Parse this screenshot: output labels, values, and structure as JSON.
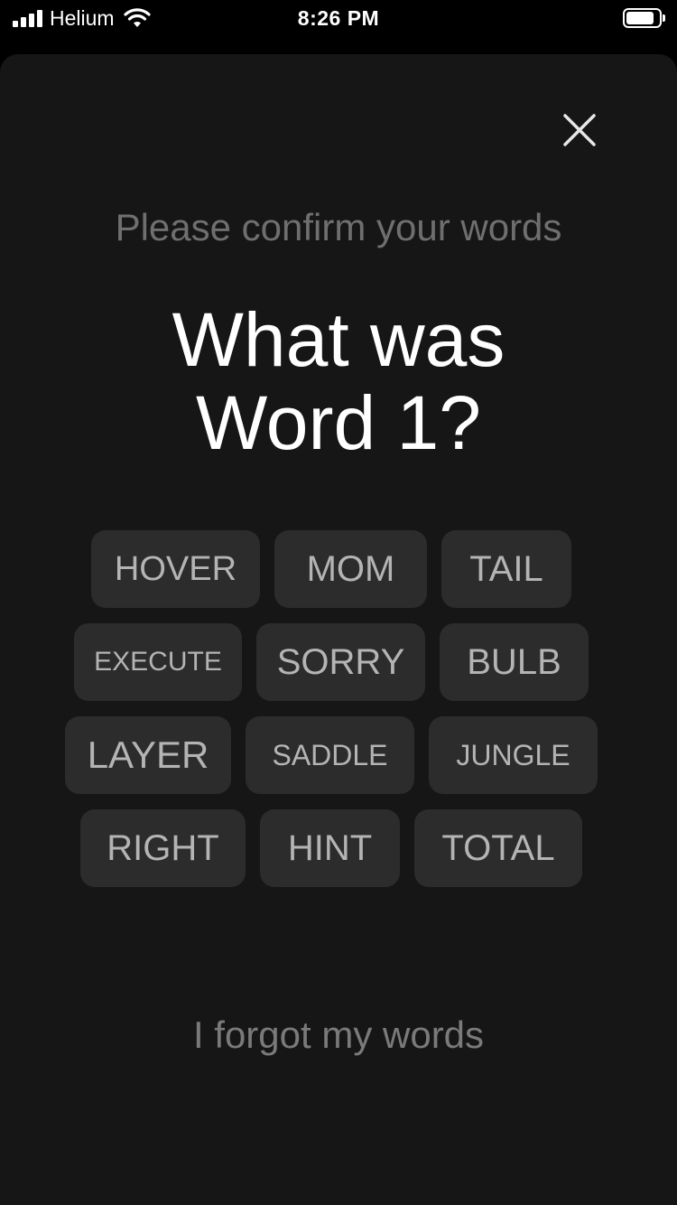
{
  "status_bar": {
    "carrier": "Helium",
    "time": "8:26 PM"
  },
  "confirm_words": {
    "subtitle": "Please confirm your words",
    "question_line1": "What was",
    "question_line2": "Word 1?",
    "chips": [
      [
        "HOVER",
        "MOM",
        "TAIL"
      ],
      [
        "EXECUTE",
        "SORRY",
        "BULB"
      ],
      [
        "LAYER",
        "SADDLE",
        "JUNGLE"
      ],
      [
        "RIGHT",
        "HINT",
        "TOTAL"
      ]
    ],
    "forgot_label": "I forgot my words"
  },
  "icons": {
    "close": "close-icon",
    "signal": "signal-bars-icon",
    "wifi": "wifi-icon",
    "battery": "battery-icon"
  },
  "colors": {
    "background": "#161616",
    "chip_background": "#2c2c2c",
    "chip_text": "#b4b4b4",
    "subtitle_text": "#6f6f6f",
    "heading_text": "#ffffff"
  }
}
